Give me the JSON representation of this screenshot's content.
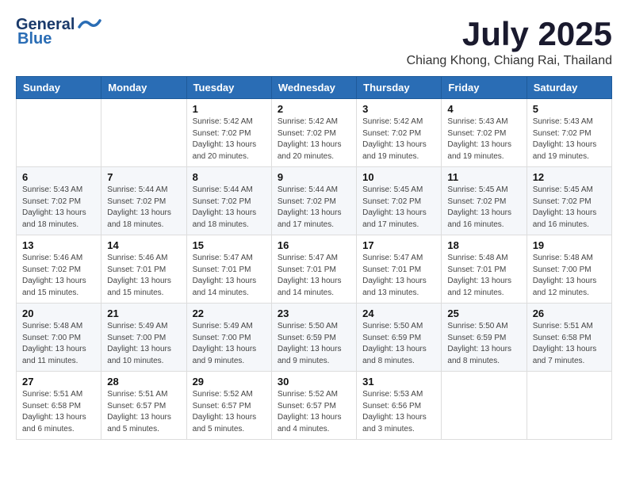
{
  "logo": {
    "line1": "General",
    "line2": "Blue"
  },
  "title": {
    "month": "July 2025",
    "location": "Chiang Khong, Chiang Rai, Thailand"
  },
  "weekdays": [
    "Sunday",
    "Monday",
    "Tuesday",
    "Wednesday",
    "Thursday",
    "Friday",
    "Saturday"
  ],
  "weeks": [
    [
      {
        "day": "",
        "info": ""
      },
      {
        "day": "",
        "info": ""
      },
      {
        "day": "1",
        "info": "Sunrise: 5:42 AM\nSunset: 7:02 PM\nDaylight: 13 hours\nand 20 minutes."
      },
      {
        "day": "2",
        "info": "Sunrise: 5:42 AM\nSunset: 7:02 PM\nDaylight: 13 hours\nand 20 minutes."
      },
      {
        "day": "3",
        "info": "Sunrise: 5:42 AM\nSunset: 7:02 PM\nDaylight: 13 hours\nand 19 minutes."
      },
      {
        "day": "4",
        "info": "Sunrise: 5:43 AM\nSunset: 7:02 PM\nDaylight: 13 hours\nand 19 minutes."
      },
      {
        "day": "5",
        "info": "Sunrise: 5:43 AM\nSunset: 7:02 PM\nDaylight: 13 hours\nand 19 minutes."
      }
    ],
    [
      {
        "day": "6",
        "info": "Sunrise: 5:43 AM\nSunset: 7:02 PM\nDaylight: 13 hours\nand 18 minutes."
      },
      {
        "day": "7",
        "info": "Sunrise: 5:44 AM\nSunset: 7:02 PM\nDaylight: 13 hours\nand 18 minutes."
      },
      {
        "day": "8",
        "info": "Sunrise: 5:44 AM\nSunset: 7:02 PM\nDaylight: 13 hours\nand 18 minutes."
      },
      {
        "day": "9",
        "info": "Sunrise: 5:44 AM\nSunset: 7:02 PM\nDaylight: 13 hours\nand 17 minutes."
      },
      {
        "day": "10",
        "info": "Sunrise: 5:45 AM\nSunset: 7:02 PM\nDaylight: 13 hours\nand 17 minutes."
      },
      {
        "day": "11",
        "info": "Sunrise: 5:45 AM\nSunset: 7:02 PM\nDaylight: 13 hours\nand 16 minutes."
      },
      {
        "day": "12",
        "info": "Sunrise: 5:45 AM\nSunset: 7:02 PM\nDaylight: 13 hours\nand 16 minutes."
      }
    ],
    [
      {
        "day": "13",
        "info": "Sunrise: 5:46 AM\nSunset: 7:02 PM\nDaylight: 13 hours\nand 15 minutes."
      },
      {
        "day": "14",
        "info": "Sunrise: 5:46 AM\nSunset: 7:01 PM\nDaylight: 13 hours\nand 15 minutes."
      },
      {
        "day": "15",
        "info": "Sunrise: 5:47 AM\nSunset: 7:01 PM\nDaylight: 13 hours\nand 14 minutes."
      },
      {
        "day": "16",
        "info": "Sunrise: 5:47 AM\nSunset: 7:01 PM\nDaylight: 13 hours\nand 14 minutes."
      },
      {
        "day": "17",
        "info": "Sunrise: 5:47 AM\nSunset: 7:01 PM\nDaylight: 13 hours\nand 13 minutes."
      },
      {
        "day": "18",
        "info": "Sunrise: 5:48 AM\nSunset: 7:01 PM\nDaylight: 13 hours\nand 12 minutes."
      },
      {
        "day": "19",
        "info": "Sunrise: 5:48 AM\nSunset: 7:00 PM\nDaylight: 13 hours\nand 12 minutes."
      }
    ],
    [
      {
        "day": "20",
        "info": "Sunrise: 5:48 AM\nSunset: 7:00 PM\nDaylight: 13 hours\nand 11 minutes."
      },
      {
        "day": "21",
        "info": "Sunrise: 5:49 AM\nSunset: 7:00 PM\nDaylight: 13 hours\nand 10 minutes."
      },
      {
        "day": "22",
        "info": "Sunrise: 5:49 AM\nSunset: 7:00 PM\nDaylight: 13 hours\nand 9 minutes."
      },
      {
        "day": "23",
        "info": "Sunrise: 5:50 AM\nSunset: 6:59 PM\nDaylight: 13 hours\nand 9 minutes."
      },
      {
        "day": "24",
        "info": "Sunrise: 5:50 AM\nSunset: 6:59 PM\nDaylight: 13 hours\nand 8 minutes."
      },
      {
        "day": "25",
        "info": "Sunrise: 5:50 AM\nSunset: 6:59 PM\nDaylight: 13 hours\nand 8 minutes."
      },
      {
        "day": "26",
        "info": "Sunrise: 5:51 AM\nSunset: 6:58 PM\nDaylight: 13 hours\nand 7 minutes."
      }
    ],
    [
      {
        "day": "27",
        "info": "Sunrise: 5:51 AM\nSunset: 6:58 PM\nDaylight: 13 hours\nand 6 minutes."
      },
      {
        "day": "28",
        "info": "Sunrise: 5:51 AM\nSunset: 6:57 PM\nDaylight: 13 hours\nand 5 minutes."
      },
      {
        "day": "29",
        "info": "Sunrise: 5:52 AM\nSunset: 6:57 PM\nDaylight: 13 hours\nand 5 minutes."
      },
      {
        "day": "30",
        "info": "Sunrise: 5:52 AM\nSunset: 6:57 PM\nDaylight: 13 hours\nand 4 minutes."
      },
      {
        "day": "31",
        "info": "Sunrise: 5:53 AM\nSunset: 6:56 PM\nDaylight: 13 hours\nand 3 minutes."
      },
      {
        "day": "",
        "info": ""
      },
      {
        "day": "",
        "info": ""
      }
    ]
  ]
}
